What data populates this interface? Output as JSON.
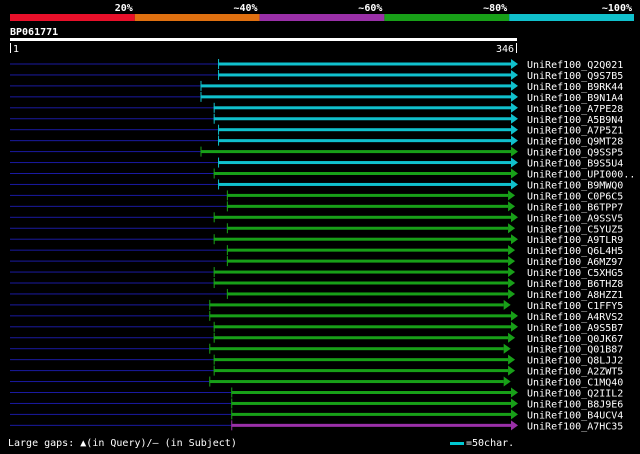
{
  "query_id": "BP061771",
  "query_start": "1",
  "query_end": "346",
  "footer": {
    "gaps_label": "Large gaps:",
    "query_gap_glyph": "▲",
    "query_gap_text": "(in Query)/",
    "subject_gap_glyph": "—",
    "subject_gap_text": "(in Subject)",
    "scale_text": "=50char."
  },
  "colors": {
    "background": "#000000",
    "c20": "#e8102a",
    "c40": "#e07010",
    "c60": "#9a30a8",
    "c80": "#18a018",
    "c100": "#10c0cc",
    "unaligned": "#1a1aa0",
    "text": "#ffffff"
  },
  "chart_data": {
    "type": "alignment",
    "identity_legend": [
      {
        "label": "20%",
        "color": "#e8102a"
      },
      {
        "label": "~40%",
        "color": "#e07010"
      },
      {
        "label": "~60%",
        "color": "#9a30a8"
      },
      {
        "label": "~80%",
        "color": "#18a018"
      },
      {
        "label": "~100%",
        "color": "#10c0cc"
      }
    ],
    "query_length": 346,
    "hits": [
      {
        "name": "UniRef100_Q2Q021",
        "start": 142,
        "end": 346,
        "identity": "~100%"
      },
      {
        "name": "UniRef100_Q9S7B5",
        "start": 142,
        "end": 346,
        "identity": "~100%"
      },
      {
        "name": "UniRef100_B9RK44",
        "start": 130,
        "end": 346,
        "identity": "~100%"
      },
      {
        "name": "UniRef100_B9N1A4",
        "start": 130,
        "end": 346,
        "identity": "~100%"
      },
      {
        "name": "UniRef100_A7PE28",
        "start": 139,
        "end": 346,
        "identity": "~100%"
      },
      {
        "name": "UniRef100_A5B9N4",
        "start": 139,
        "end": 346,
        "identity": "~100%"
      },
      {
        "name": "UniRef100_A7P5Z1",
        "start": 142,
        "end": 346,
        "identity": "~100%"
      },
      {
        "name": "UniRef100_Q9MT28",
        "start": 142,
        "end": 346,
        "identity": "~100%"
      },
      {
        "name": "UniRef100_Q9SSP5",
        "start": 130,
        "end": 346,
        "identity": "~80%"
      },
      {
        "name": "UniRef100_B9S5U4",
        "start": 142,
        "end": 346,
        "identity": "~100%"
      },
      {
        "name": "UniRef100_UPI000..",
        "start": 139,
        "end": 346,
        "identity": "~80%"
      },
      {
        "name": "UniRef100_B9MWQ0",
        "start": 142,
        "end": 346,
        "identity": "~100%"
      },
      {
        "name": "UniRef100_C0P6C5",
        "start": 148,
        "end": 344,
        "identity": "~80%"
      },
      {
        "name": "UniRef100_B6TPP7",
        "start": 148,
        "end": 344,
        "identity": "~80%"
      },
      {
        "name": "UniRef100_A9SSV5",
        "start": 139,
        "end": 346,
        "identity": "~80%"
      },
      {
        "name": "UniRef100_C5YUZ5",
        "start": 148,
        "end": 344,
        "identity": "~80%"
      },
      {
        "name": "UniRef100_A9TLR9",
        "start": 139,
        "end": 346,
        "identity": "~80%"
      },
      {
        "name": "UniRef100_Q6L4H5",
        "start": 148,
        "end": 344,
        "identity": "~80%"
      },
      {
        "name": "UniRef100_A6MZ97",
        "start": 148,
        "end": 344,
        "identity": "~80%"
      },
      {
        "name": "UniRef100_C5XHG5",
        "start": 139,
        "end": 344,
        "identity": "~80%"
      },
      {
        "name": "UniRef100_B6THZ8",
        "start": 139,
        "end": 344,
        "identity": "~80%"
      },
      {
        "name": "UniRef100_A8HZZ1",
        "start": 148,
        "end": 344,
        "identity": "~80%"
      },
      {
        "name": "UniRef100_C1FFY5",
        "start": 136,
        "end": 341,
        "identity": "~80%"
      },
      {
        "name": "UniRef100_A4RVS2",
        "start": 136,
        "end": 346,
        "identity": "~80%"
      },
      {
        "name": "UniRef100_A9S5B7",
        "start": 139,
        "end": 346,
        "identity": "~80%"
      },
      {
        "name": "UniRef100_Q0JK67",
        "start": 139,
        "end": 344,
        "identity": "~80%"
      },
      {
        "name": "UniRef100_Q01B87",
        "start": 136,
        "end": 341,
        "identity": "~80%"
      },
      {
        "name": "UniRef100_Q8LJJ2",
        "start": 139,
        "end": 344,
        "identity": "~80%"
      },
      {
        "name": "UniRef100_A2ZWT5",
        "start": 139,
        "end": 344,
        "identity": "~80%"
      },
      {
        "name": "UniRef100_C1MQ40",
        "start": 136,
        "end": 341,
        "identity": "~80%"
      },
      {
        "name": "UniRef100_Q2IIL2",
        "start": 151,
        "end": 346,
        "identity": "~80%"
      },
      {
        "name": "UniRef100_B8J9E6",
        "start": 151,
        "end": 346,
        "identity": "~80%"
      },
      {
        "name": "UniRef100_B4UCV4",
        "start": 151,
        "end": 346,
        "identity": "~80%"
      },
      {
        "name": "UniRef100_A7HC35",
        "start": 151,
        "end": 346,
        "identity": "~60%"
      }
    ]
  }
}
